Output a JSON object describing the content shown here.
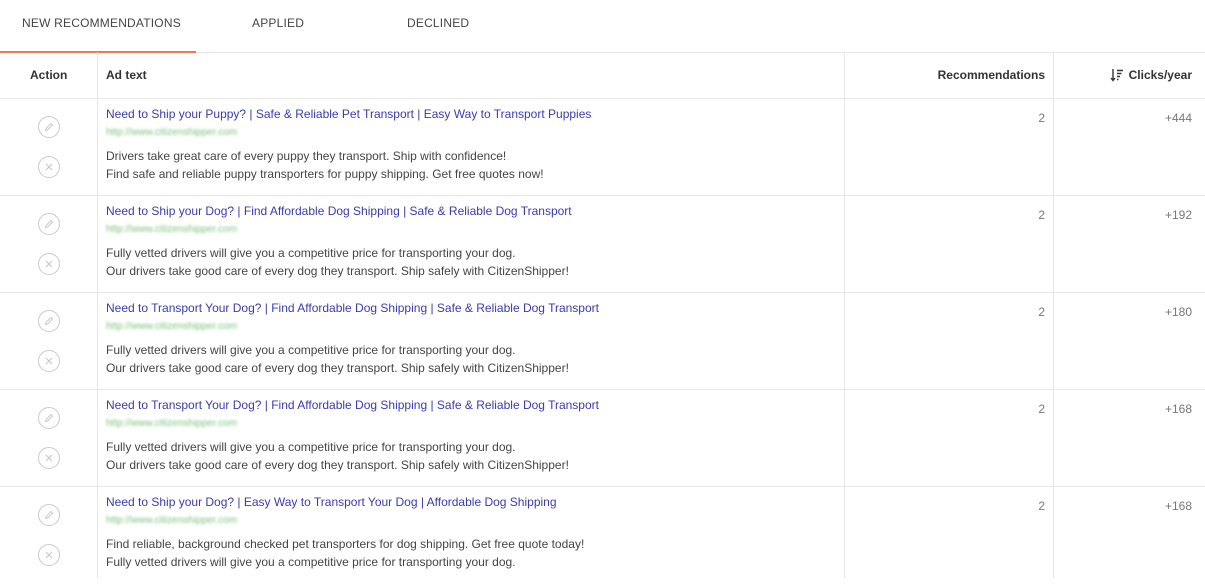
{
  "tabs": [
    {
      "label": "NEW RECOMMENDATIONS"
    },
    {
      "label": "APPLIED"
    },
    {
      "label": "DECLINED"
    }
  ],
  "columns": {
    "action": "Action",
    "ad_text": "Ad text",
    "recommendations": "Recommendations",
    "clicks": "Clicks/year"
  },
  "accent_color": "#f07a4a",
  "link_color": "#3b3bab",
  "icons": {
    "edit": "pencil-icon",
    "decline": "close-icon",
    "sort": "sort-desc-icon"
  },
  "rows": [
    {
      "title": "Need to Ship your Puppy? | Safe & Reliable Pet Transport | Easy Way to Transport Puppies",
      "url": "http://www.citizenshipper.com",
      "desc1": "Drivers take great care of every puppy they transport. Ship with confidence!",
      "desc2": "Find safe and reliable puppy transporters for puppy shipping. Get free quotes now!",
      "recommendations": "2",
      "clicks": "+444"
    },
    {
      "title": "Need to Ship your Dog? | Find Affordable Dog Shipping | Safe & Reliable Dog Transport",
      "url": "http://www.citizenshipper.com",
      "desc1": "Fully vetted drivers will give you a competitive price for transporting your dog.",
      "desc2": "Our drivers take good care of every dog they transport. Ship safely with CitizenShipper!",
      "recommendations": "2",
      "clicks": "+192"
    },
    {
      "title": "Need to Transport Your Dog? | Find Affordable Dog Shipping | Safe & Reliable Dog Transport",
      "url": "http://www.citizenshipper.com",
      "desc1": "Fully vetted drivers will give you a competitive price for transporting your dog.",
      "desc2": "Our drivers take good care of every dog they transport. Ship safely with CitizenShipper!",
      "recommendations": "2",
      "clicks": "+180"
    },
    {
      "title": "Need to Transport Your Dog? | Find Affordable Dog Shipping | Safe & Reliable Dog Transport",
      "url": "http://www.citizenshipper.com",
      "desc1": "Fully vetted drivers will give you a competitive price for transporting your dog.",
      "desc2": "Our drivers take good care of every dog they transport. Ship safely with CitizenShipper!",
      "recommendations": "2",
      "clicks": "+168"
    },
    {
      "title": "Need to Ship your Dog? | Easy Way to Transport Your Dog | Affordable Dog Shipping",
      "url": "http://www.citizenshipper.com",
      "desc1": "Find reliable, background checked pet transporters for dog shipping. Get free quote today!",
      "desc2": "Fully vetted drivers will give you a competitive price for transporting your dog.",
      "recommendations": "2",
      "clicks": "+168"
    }
  ]
}
